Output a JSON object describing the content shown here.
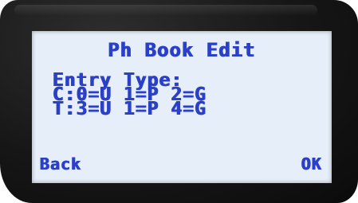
{
  "screen": {
    "title": "Ph Book Edit",
    "lines": [
      "Entry Type:",
      "C:0=U 1=P 2=G",
      "T:3=U 1=P 4=G"
    ]
  },
  "softkeys": {
    "left": "Back",
    "right": "OK"
  },
  "colors": {
    "lcd_text": "#2b40c8",
    "lcd_background": "#e6eff9",
    "bezel": "#161616"
  }
}
